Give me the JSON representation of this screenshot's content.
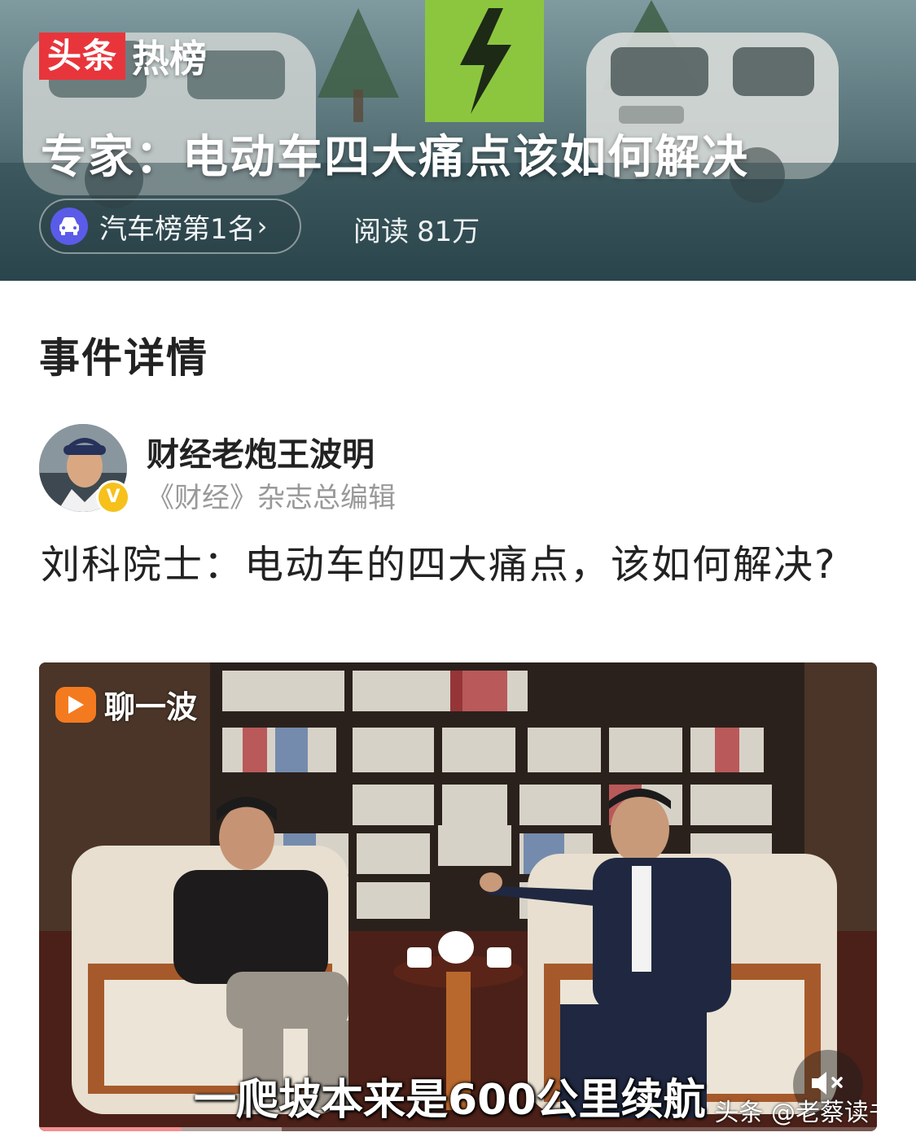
{
  "header": {
    "brand_part1": "头条",
    "brand_part2": "热榜",
    "headline": "专家：电动车四大痛点该如何解决",
    "rank_label": "汽车榜第1名",
    "reads_label": "阅读",
    "reads_value": "81万",
    "icons": {
      "rank": "car-icon",
      "rank_more": "chevron-right-icon"
    },
    "colors": {
      "brand_red": "#e8353b",
      "rank_icon_bg": "#5a5be8"
    }
  },
  "section": {
    "title": "事件详情"
  },
  "author": {
    "name": "财经老炮王波明",
    "description": "《财经》杂志总编辑",
    "verified_badge": "V"
  },
  "post": {
    "title": "刘科院士：电动车的四大痛点，该如何解决?"
  },
  "video": {
    "channel_name": "聊一波",
    "subtitle": "一爬坡本来是600公里续航",
    "watermark": "头条 @老蔡读书",
    "progress_fraction": 0.17,
    "buffered_fraction": 0.29,
    "icons": {
      "channel": "play-icon",
      "audio": "mute-icon"
    }
  }
}
